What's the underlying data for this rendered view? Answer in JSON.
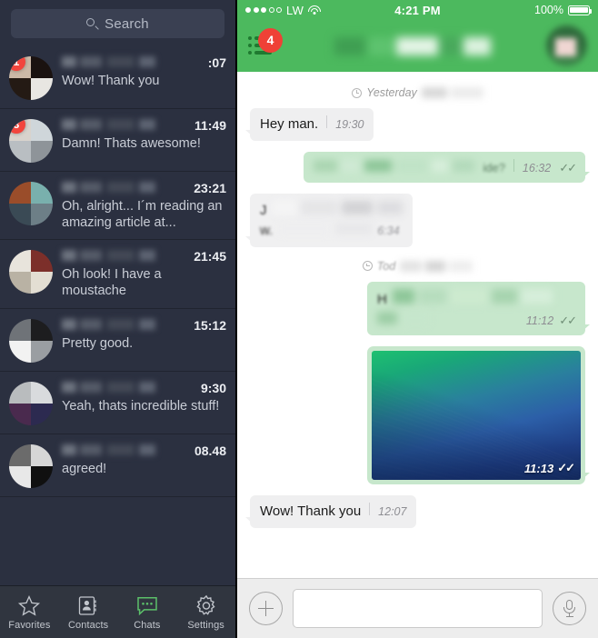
{
  "sidebar": {
    "search": {
      "placeholder": "Search",
      "icon": "search-icon"
    },
    "chats": [
      {
        "name_redacted": true,
        "time": ":07",
        "preview": "Wow! Thank you",
        "badge": "1",
        "avatar_colors": [
          "#cbb9a7",
          "#1a1210",
          "#241a14",
          "#e8e6e2"
        ]
      },
      {
        "name_redacted": true,
        "time": "11:49",
        "preview": "Damn! Thats awesome!",
        "badge": "3",
        "avatar_colors": [
          "#d8d3cd",
          "#cfd6da",
          "#b9bec2",
          "#8e9499"
        ]
      },
      {
        "name_redacted": true,
        "time": "23:21",
        "preview": "Oh, alright... I´m reading an amazing article at...",
        "badge": "",
        "avatar_colors": [
          "#9a4d2a",
          "#79b0ad",
          "#3a4a55",
          "#6d7f87"
        ]
      },
      {
        "name_redacted": true,
        "time": "21:45",
        "preview": "Oh look! I have a moustache",
        "badge": "",
        "avatar_colors": [
          "#e8e4dc",
          "#7c2f2a",
          "#b9b2a4",
          "#e3ded3"
        ]
      },
      {
        "name_redacted": true,
        "time": "15:12",
        "preview": "Pretty good.",
        "badge": "",
        "avatar_colors": [
          "#6f7378",
          "#1d1d1f",
          "#f2f2f2",
          "#9a9ea2"
        ]
      },
      {
        "name_redacted": true,
        "time": "9:30",
        "preview": "Yeah, thats incredible stuff!",
        "badge": "",
        "avatar_colors": [
          "#b9bcbe",
          "#d9dbdd",
          "#4a2a4e",
          "#2c2a50"
        ]
      },
      {
        "name_redacted": true,
        "time": "08.48",
        "preview": "agreed!",
        "badge": "",
        "avatar_colors": [
          "#6b6b6b",
          "#d6d6d6",
          "#e8e8e8",
          "#101010"
        ]
      }
    ]
  },
  "tabbar": {
    "items": [
      {
        "label": "Favorites",
        "icon": "star-icon",
        "active": false
      },
      {
        "label": "Contacts",
        "icon": "contact-card-icon",
        "active": false
      },
      {
        "label": "Chats",
        "icon": "chat-bubble-icon",
        "active": true
      },
      {
        "label": "Settings",
        "icon": "gear-icon",
        "active": false
      }
    ],
    "active_color": "#5cc06a"
  },
  "statusbar": {
    "signal_filled": 3,
    "signal_empty": 2,
    "carrier": "LW",
    "wifi": "wifi-icon",
    "time": "4:21 PM",
    "battery_percent": "100%",
    "battery_icon": "battery-full-icon"
  },
  "navbar": {
    "list_icon": "list-icon",
    "unread_badge": "4",
    "title_redacted": true,
    "avatar": "contact-avatar",
    "bg_color": "#4cb95e"
  },
  "conversation": {
    "dividers": {
      "yesterday": {
        "label": "Yesterday",
        "icon": "clock-icon",
        "date_redacted": true
      },
      "today": {
        "label": "Tod",
        "icon": "clock-icon",
        "date_redacted": true
      }
    },
    "messages": [
      {
        "direction": "in",
        "text": "Hey man.",
        "time": "19:30",
        "status": "",
        "redacted": false
      },
      {
        "direction": "out",
        "text": "",
        "tail_text": "ide?",
        "time": "16:32",
        "status": "✓✓",
        "redacted": true
      },
      {
        "direction": "in",
        "text": "",
        "lead_text": "J",
        "second_line": "w.",
        "time": "6:34",
        "status": "",
        "redacted": true
      },
      {
        "direction": "out",
        "text": "",
        "lead_text": "H",
        "time": "11:12",
        "status": "✓✓",
        "redacted": true
      },
      {
        "direction": "out",
        "type": "photo",
        "time": "11:13",
        "status": "✓✓",
        "photo_alt": "wave-wallpaper-image"
      },
      {
        "direction": "in",
        "text": "Wow! Thank you",
        "time": "12:07",
        "status": "",
        "redacted": false
      }
    ]
  },
  "composer": {
    "attach_icon": "plus-icon",
    "input_value": "",
    "input_placeholder": "",
    "mic_icon": "microphone-icon"
  },
  "colors": {
    "sidebar_bg": "#2b3040",
    "header_green": "#4cb95e",
    "bubble_out": "#c7e7cc",
    "bubble_in": "#efeff0",
    "badge_red": "#ef4136"
  }
}
